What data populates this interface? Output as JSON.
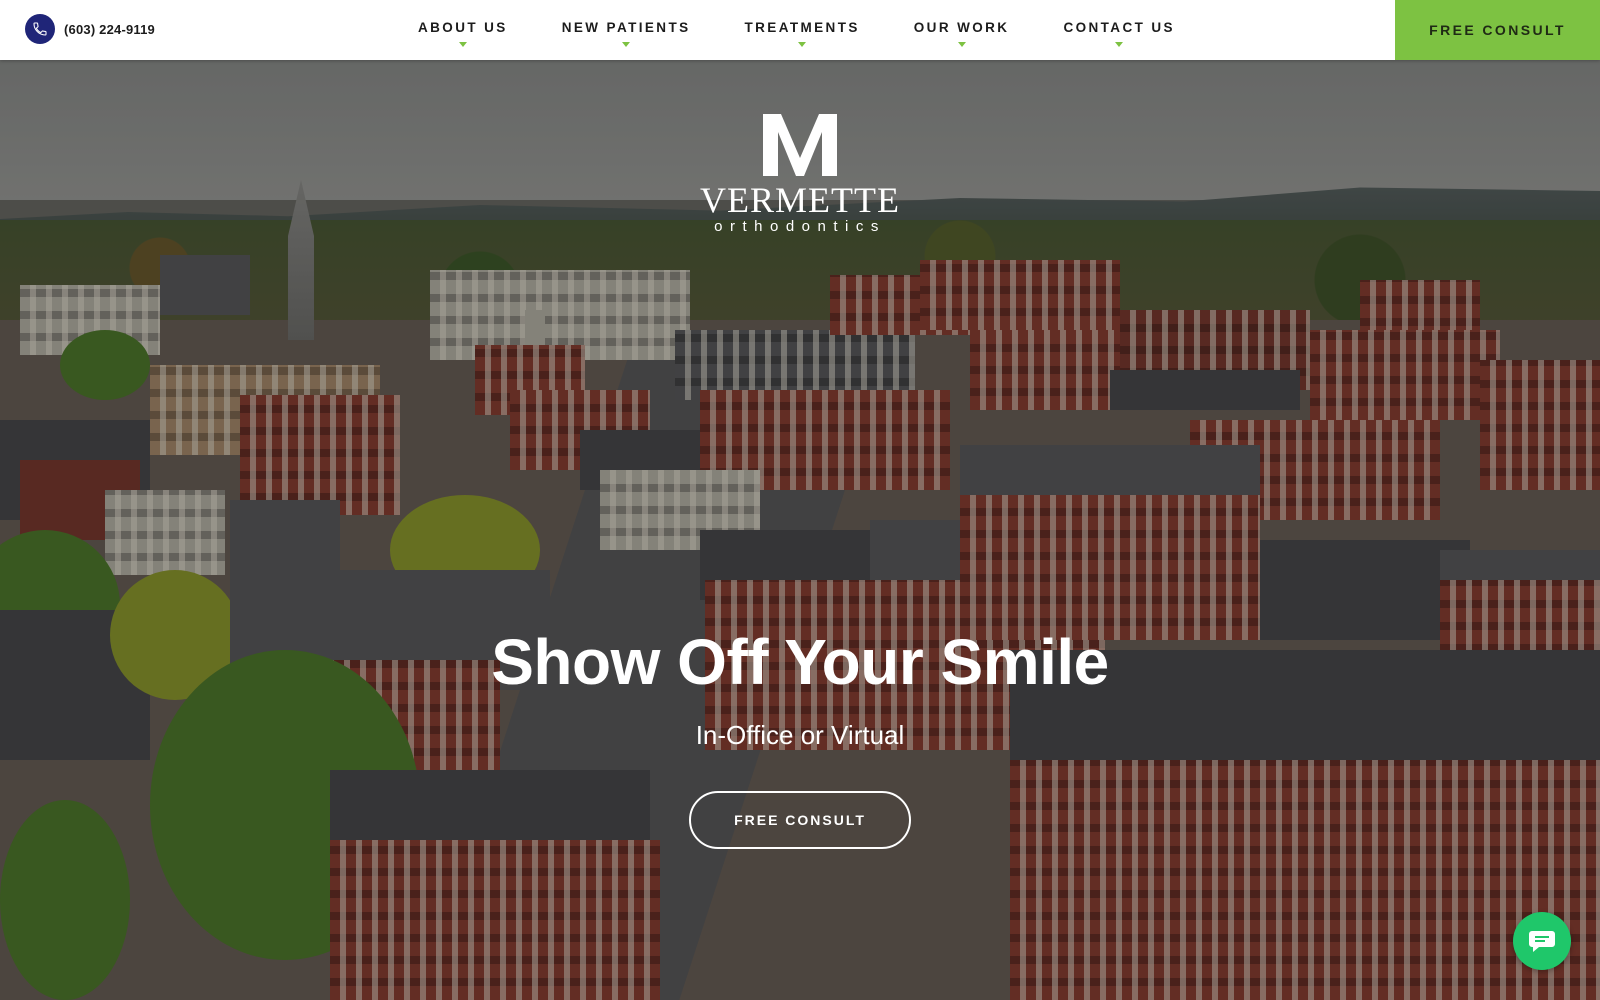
{
  "header": {
    "phone": "(603) 224-9119",
    "nav": [
      "ABOUT US",
      "NEW PATIENTS",
      "TREATMENTS",
      "OUR WORK",
      "CONTACT US"
    ],
    "cta_label": "FREE CONSULT",
    "accent_color": "#7dc242",
    "phone_icon_color": "#1f2578"
  },
  "logo": {
    "name": "VERMETTE",
    "subtitle": "orthodontics"
  },
  "hero": {
    "headline": "Show Off Your Smile",
    "subheadline": "In-Office or Virtual",
    "cta_label": "FREE CONSULT"
  },
  "chat": {
    "icon": "chat-bubble-icon",
    "color": "#1fc76a"
  }
}
